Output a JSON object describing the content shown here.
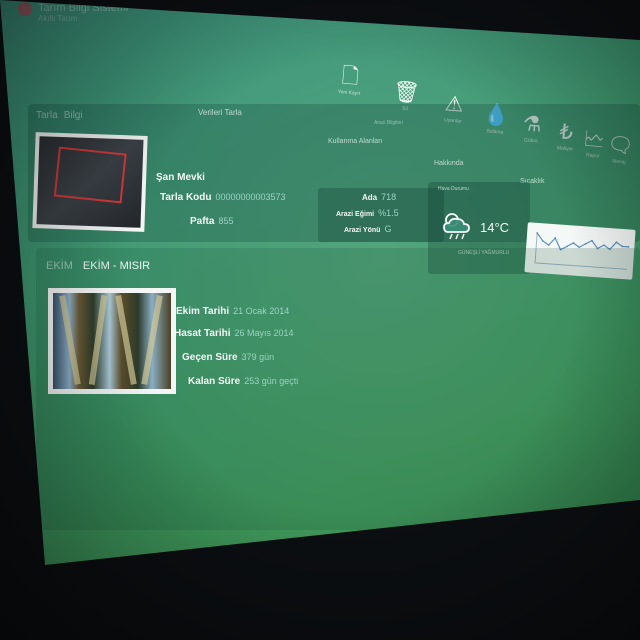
{
  "app": {
    "logo_title": "Tarım Bilgi Sistemi",
    "logo_subtitle": "Akıllı Tarım"
  },
  "toolbar": [
    {
      "icon": "document-icon",
      "glyph": "🗋",
      "label": "Yeni Kayıt"
    },
    {
      "icon": "trash-icon",
      "glyph": "🗑",
      "label": "Sil"
    },
    {
      "icon": "warning-icon",
      "glyph": "⚠",
      "label": "Uyarılar"
    },
    {
      "icon": "water-drop-icon",
      "glyph": "💧",
      "label": "Sulama"
    },
    {
      "icon": "flask-icon",
      "glyph": "⚗",
      "label": "Gübre"
    },
    {
      "icon": "lira-icon",
      "glyph": "₺",
      "label": "Maliyet"
    },
    {
      "icon": "report-icon",
      "glyph": "🗠",
      "label": "Rapor"
    },
    {
      "icon": "chat-icon",
      "glyph": "🗨",
      "label": "Mesaj"
    }
  ],
  "field_panel": {
    "header_left": "Tarla",
    "header_left_alt": "Bilgi",
    "header_center": "Verileri Tarla",
    "header_right": "Arazi Bilgileri",
    "section_center": "Kullanma Alanları",
    "section_right": "Hakkında",
    "section_weather": "Hava Durumu",
    "section_chart": "Sıcaklık",
    "mevki": "Şan Mevki",
    "tarla_kodu_label": "Tarla Kodu",
    "tarla_kodu_value": "00000000003573",
    "pafta_label": "Pafta",
    "pafta_value": "855",
    "ada_label": "Ada",
    "ada_value": "718",
    "egim_label": "Arazi Eğimi",
    "egim_value": "%1.5",
    "yon_label": "Arazi Yönü",
    "yon_value": "G"
  },
  "weather": {
    "icon": "cloudy-rain-icon",
    "temperature": "14°C",
    "description": "GÜNEŞLİ YAĞMURLU"
  },
  "chart_data": {
    "type": "line",
    "values": [
      8,
      6,
      5,
      7,
      4,
      5,
      6,
      5,
      6,
      7,
      5,
      6,
      5,
      7,
      6,
      6
    ]
  },
  "crop_panel": {
    "tag": "EKİM",
    "title": "EKİM - MISIR",
    "ekim_label": "Ekim Tarihi",
    "ekim_value": "21 Ocak 2014",
    "hasat_label": "Hasat Tarihi",
    "hasat_value": "26 Mayıs 2014",
    "gecen_label": "Geçen Süre",
    "gecen_value": "379 gün",
    "kalan_label": "Kalan Süre",
    "kalan_value": "253 gün geçti"
  }
}
